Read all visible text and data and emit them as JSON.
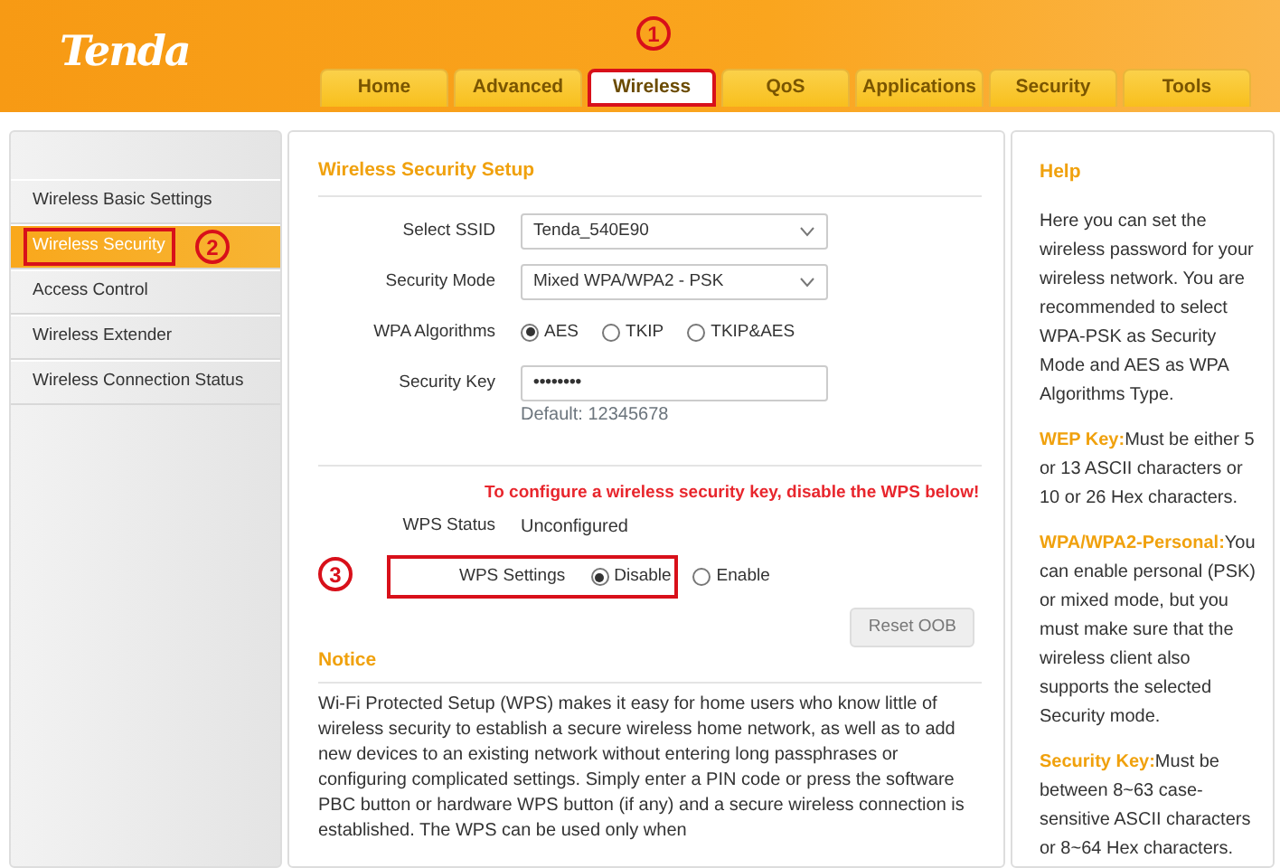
{
  "logo": "Tenda",
  "tabs": [
    {
      "label": "Home",
      "selected": false
    },
    {
      "label": "Advanced",
      "selected": false
    },
    {
      "label": "Wireless",
      "selected": true,
      "boxed": true,
      "callout": "1"
    },
    {
      "label": "QoS",
      "selected": false
    },
    {
      "label": "Applications",
      "selected": false
    },
    {
      "label": "Security",
      "selected": false
    },
    {
      "label": "Tools",
      "selected": false
    }
  ],
  "sidebar": {
    "items": [
      {
        "label": "Wireless Basic Settings",
        "selected": false
      },
      {
        "label": "Wireless Security",
        "selected": true,
        "boxed": true,
        "callout": "2"
      },
      {
        "label": "Access Control",
        "selected": false
      },
      {
        "label": "Wireless Extender",
        "selected": false
      },
      {
        "label": "Wireless Connection Status",
        "selected": false
      }
    ]
  },
  "main": {
    "title": "Wireless Security Setup",
    "rows": [
      {
        "kind": "select",
        "label": "Select SSID",
        "value": "Tenda_540E90"
      },
      {
        "kind": "select",
        "label": "Security Mode",
        "value": "Mixed WPA/WPA2 - PSK"
      },
      {
        "kind": "radios",
        "label": "WPA Algorithms",
        "options": [
          {
            "label": "AES",
            "selected": true
          },
          {
            "label": "TKIP",
            "selected": false
          },
          {
            "label": "TKIP&AES",
            "selected": false
          }
        ]
      },
      {
        "kind": "password",
        "label": "Security Key",
        "value": "••••••••",
        "hint": "Default: 12345678"
      }
    ],
    "warning": "To configure a wireless security key, disable the WPS below!",
    "wps_status": {
      "label": "WPS Status",
      "value": "Unconfigured"
    },
    "wps_settings": {
      "label": "WPS Settings",
      "boxed": true,
      "callout": "3",
      "options": [
        {
          "label": "Disable",
          "selected": true
        },
        {
          "label": "Enable",
          "selected": false
        }
      ]
    },
    "reset_button": "Reset OOB",
    "notice": {
      "title": "Notice",
      "text": "Wi-Fi Protected Setup (WPS) makes it easy for home users who know little of wireless security to establish a secure wireless home network, as well as to add new devices to an existing network without entering long passphrases or configuring complicated settings. Simply enter a PIN code or press the software PBC button or hardware WPS button (if any) and a secure wireless connection is established. The WPS can be used only when"
    }
  },
  "help": {
    "title": "Help",
    "paragraphs": [
      "Here you can set the wireless password for your wireless network. You are recommended to select WPA-PSK as Security Mode and AES as WPA Algorithms Type.",
      "**WEP Key:**Must be either 5 or 13 ASCII characters or 10 or 26 Hex characters.",
      "**WPA/WPA2-Personal:**You can enable personal (PSK) or mixed mode, but you must make sure that the wireless client also supports the selected Security mode.",
      "**Security Key:**Must be between 8~63 case-sensitive ASCII characters or 8~64 Hex characters."
    ]
  }
}
